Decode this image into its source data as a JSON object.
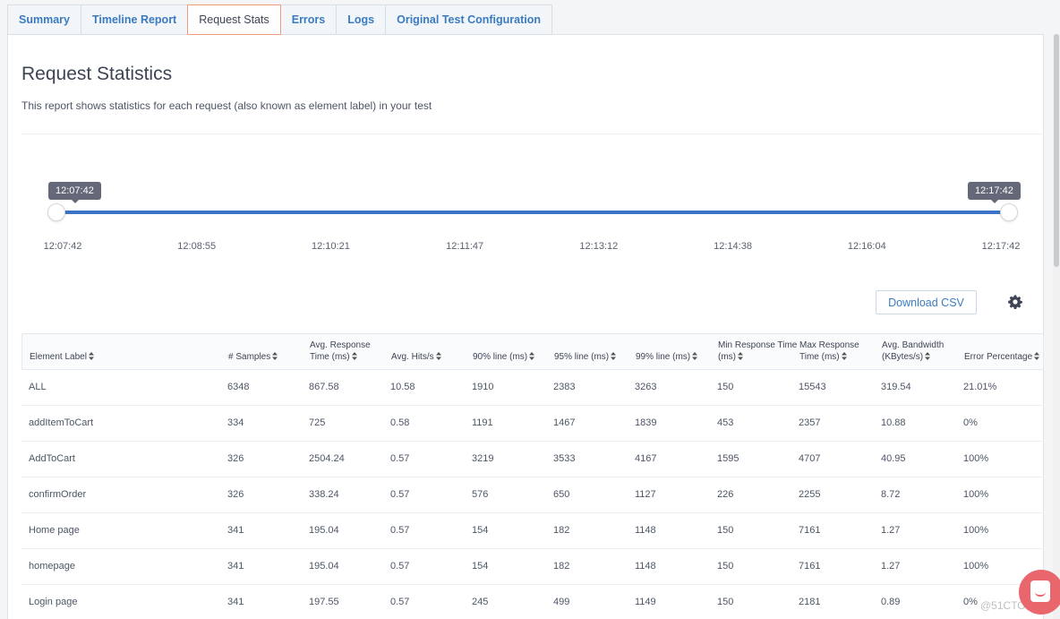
{
  "tabs": [
    {
      "label": "Summary",
      "active": false
    },
    {
      "label": "Timeline Report",
      "active": false
    },
    {
      "label": "Request Stats",
      "active": true
    },
    {
      "label": "Errors",
      "active": false
    },
    {
      "label": "Logs",
      "active": false
    },
    {
      "label": "Original Test Configuration",
      "active": false
    }
  ],
  "page": {
    "title": "Request Statistics",
    "description": "This report shows statistics for each request (also known as element label) in your test"
  },
  "time_range": {
    "start_label": "12:07:42",
    "end_label": "12:17:42",
    "selected_start_fraction": 0,
    "selected_end_fraction": 1,
    "ticks": [
      "12:07:42",
      "12:08:55",
      "12:10:21",
      "12:11:47",
      "12:13:12",
      "12:14:38",
      "12:16:04",
      "12:17:42"
    ]
  },
  "toolbar": {
    "download_csv_label": "Download CSV",
    "settings_icon": "gear-icon"
  },
  "table": {
    "columns": [
      {
        "line1": "",
        "line2": "Element Label"
      },
      {
        "line1": "",
        "line2": "# Samples"
      },
      {
        "line1": "Avg. Response",
        "line2": "Time (ms)"
      },
      {
        "line1": "",
        "line2": "Avg. Hits/s"
      },
      {
        "line1": "",
        "line2": "90% line (ms)"
      },
      {
        "line1": "",
        "line2": "95% line (ms)"
      },
      {
        "line1": "",
        "line2": "99% line (ms)"
      },
      {
        "line1": "Min Response Time",
        "line2": "(ms)"
      },
      {
        "line1": "Max Response",
        "line2": "Time (ms)"
      },
      {
        "line1": "Avg. Bandwidth",
        "line2": "(KBytes/s)"
      },
      {
        "line1": "",
        "line2": "Error Percentage"
      }
    ],
    "sort_icon": "⬍",
    "rows": [
      [
        "ALL",
        "6348",
        "867.58",
        "10.58",
        "1910",
        "2383",
        "3263",
        "150",
        "15543",
        "319.54",
        "21.01%"
      ],
      [
        "addItemToCart",
        "334",
        "725",
        "0.58",
        "1191",
        "1467",
        "1839",
        "453",
        "2357",
        "10.88",
        "0%"
      ],
      [
        "AddToCart",
        "326",
        "2504.24",
        "0.57",
        "3219",
        "3533",
        "4167",
        "1595",
        "4707",
        "40.95",
        "100%"
      ],
      [
        "confirmOrder",
        "326",
        "338.24",
        "0.57",
        "576",
        "650",
        "1127",
        "226",
        "2255",
        "8.72",
        "100%"
      ],
      [
        "Home page",
        "341",
        "195.04",
        "0.57",
        "154",
        "182",
        "1148",
        "150",
        "7161",
        "1.27",
        "100%"
      ],
      [
        "homepage",
        "341",
        "195.04",
        "0.57",
        "154",
        "182",
        "1148",
        "150",
        "7161",
        "1.27",
        "100%"
      ],
      [
        "Login page",
        "341",
        "197.55",
        "0.57",
        "245",
        "499",
        "1149",
        "150",
        "2181",
        "0.89",
        "0%"
      ]
    ]
  },
  "watermark": "@51CTO博客",
  "colors": {
    "accent_blue": "#3a7bc0",
    "slider_blue": "#3c73c9",
    "active_tab_border": "#ef9d7e",
    "chat_button": "#e8666c"
  }
}
